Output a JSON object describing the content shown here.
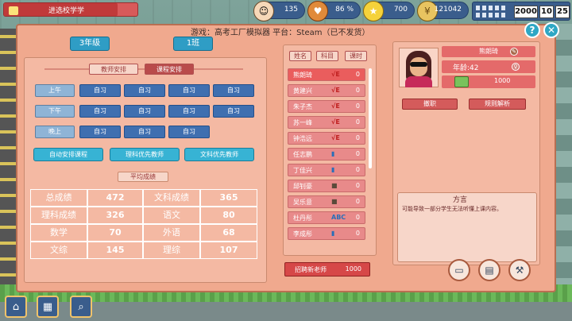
{
  "top_bar": {
    "school_name": "进选校学学",
    "stats": [
      {
        "icon": "student-icon",
        "value": "135"
      },
      {
        "icon": "heart-icon",
        "value": "86 %"
      },
      {
        "icon": "star-icon",
        "value": "700"
      },
      {
        "icon": "coin-icon",
        "value": "121042"
      }
    ],
    "date": {
      "year": "2000",
      "month": "10",
      "day": "25"
    },
    "school_progress": 0.85
  },
  "caption": "游戏：高考工厂模拟器 平台：Steam（已不发货）",
  "class_selectors": {
    "grade": "3年级",
    "class": "1班"
  },
  "tabs": {
    "teacher_schedule": "教师安排",
    "course_schedule": "课程安排"
  },
  "schedule": {
    "rows": [
      {
        "label": "上午",
        "cells": [
          "自习",
          "自习",
          "自习",
          "自习"
        ]
      },
      {
        "label": "下午",
        "cells": [
          "自习",
          "自习",
          "自习",
          "自习"
        ]
      },
      {
        "label": "晚上",
        "cells": [
          "自习",
          "自习",
          "自习"
        ]
      }
    ]
  },
  "actions": {
    "auto": "自动安排课程",
    "science": "理科优先教师",
    "arts": "文科优先教师"
  },
  "average_tab": "平均成绩",
  "scores": [
    {
      "label": "总成绩",
      "value": "472",
      "label2": "文科成绩",
      "value2": "365"
    },
    {
      "label": "理科成绩",
      "value": "326",
      "label2": "语文",
      "value2": "80"
    },
    {
      "label": "数学",
      "value": "70",
      "label2": "外语",
      "value2": "68"
    },
    {
      "label": "文综",
      "value": "145",
      "label2": "理综",
      "value2": "107"
    }
  ],
  "teacher_list": {
    "sort_buttons": [
      "姓名",
      "科目",
      "课时"
    ],
    "teachers": [
      {
        "name": "熊朗琦",
        "badge": "√E",
        "count": "0"
      },
      {
        "name": "黄建兴",
        "badge": "√E",
        "count": "0"
      },
      {
        "name": "朱子杰",
        "badge": "√E",
        "count": "0"
      },
      {
        "name": "苏一峰",
        "badge": "√E",
        "count": "0"
      },
      {
        "name": "钟浩远",
        "badge": "√E",
        "count": "0"
      },
      {
        "name": "任志鹏",
        "badge": "▮",
        "count": "0"
      },
      {
        "name": "丁佳兴",
        "badge": "▮",
        "count": "0"
      },
      {
        "name": "邱钊豪",
        "badge": "■",
        "count": "0"
      },
      {
        "name": "吴乐意",
        "badge": "■",
        "count": "0"
      },
      {
        "name": "杜丹彤",
        "badge": "ABC",
        "count": "0"
      },
      {
        "name": "李成彤",
        "badge": "▮",
        "count": "0"
      }
    ],
    "hire_label": "招聘新老师",
    "hire_cost": "1000"
  },
  "teacher_detail": {
    "name": "熊朗琦",
    "age": "年龄:42",
    "salary": "1000",
    "btn_dismiss": "撤职",
    "btn_rules": "规则解析",
    "eval_title": "方言",
    "eval_text": "可能导致一部分学生无法听懂上课内容。"
  },
  "colors": {
    "panel": "#f0a98e",
    "selected_row": "#ea5d5d",
    "cell_blue": "#3f6fb0",
    "accent_cyan": "#37b3d4"
  }
}
